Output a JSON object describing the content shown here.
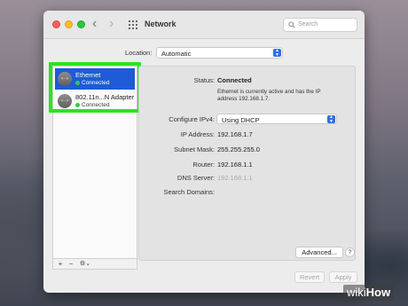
{
  "window": {
    "title": "Network",
    "search_placeholder": "Search"
  },
  "location": {
    "label": "Location:",
    "value": "Automatic"
  },
  "services": [
    {
      "name": "Ethernet",
      "status": "Connected",
      "icon": "network-icon",
      "selected": true
    },
    {
      "name": "802.11n...N Adapter",
      "status": "Connected",
      "icon": "network-icon",
      "selected": false
    }
  ],
  "sidebar_footer": {
    "add": "+",
    "remove": "−",
    "action": "⚙⌄"
  },
  "details": {
    "status_label": "Status:",
    "status_value": "Connected",
    "status_desc": "Ethernet is currently active and has the IP address 192.168.1.7.",
    "configure_label": "Configure IPv4:",
    "configure_value": "Using DHCP",
    "ip_label": "IP Address:",
    "ip_value": "192.168.1.7",
    "subnet_label": "Subnet Mask:",
    "subnet_value": "255.255.255.0",
    "router_label": "Router:",
    "router_value": "192.168.1.1",
    "dns_label": "DNS Server:",
    "dns_value": "192.168.1.1",
    "search_domains_label": "Search Domains:"
  },
  "buttons": {
    "advanced": "Advanced...",
    "help": "?",
    "revert": "Revert",
    "apply": "Apply"
  },
  "watermark": {
    "prefix": "wiki",
    "suffix": "How"
  },
  "colors": {
    "selection": "#1e5bd6",
    "highlight": "#2be31f",
    "connected_dot": "#2ccf4a"
  }
}
